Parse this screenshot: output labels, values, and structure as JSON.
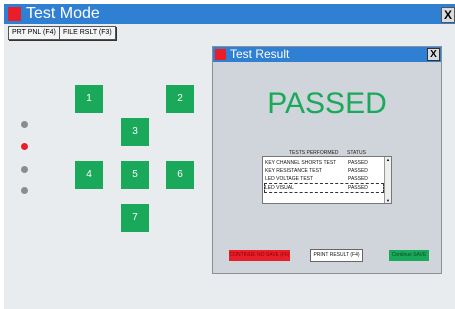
{
  "window": {
    "title": "Test Mode",
    "close_label": "X"
  },
  "toolbar": {
    "print_panel": "PRT PNL (F4)",
    "file_result": "FILE RSLT (F3)"
  },
  "keys": [
    "1",
    "2",
    "3",
    "4",
    "5",
    "6",
    "7"
  ],
  "leds": [
    {
      "on": false
    },
    {
      "on": true
    },
    {
      "on": false
    },
    {
      "on": false
    }
  ],
  "dialog": {
    "title": "Test Result",
    "close_label": "X",
    "result": "PASSED",
    "headers": {
      "tests": "TESTS PERFORMED",
      "status": "STATUS"
    },
    "rows": [
      {
        "test": "KEY CHANNEL SHORTS TEST",
        "status": "PASSED"
      },
      {
        "test": "KEY RESISTANCE TEST",
        "status": "PASSED"
      },
      {
        "test": "LED VOLTAGE TEST",
        "status": "PASSED"
      },
      {
        "test": "LED VISUAL",
        "status": "PASSED"
      }
    ],
    "buttons": {
      "continue_no_save": "CONTINUE NO SAVE (F6)",
      "print_result": "PRINT RESULT (F4)",
      "continue_save": "Continue SAVE"
    }
  },
  "colors": {
    "accent": "#2f7fd2",
    "pass": "#1aa85a",
    "fail": "#e81f2a"
  }
}
